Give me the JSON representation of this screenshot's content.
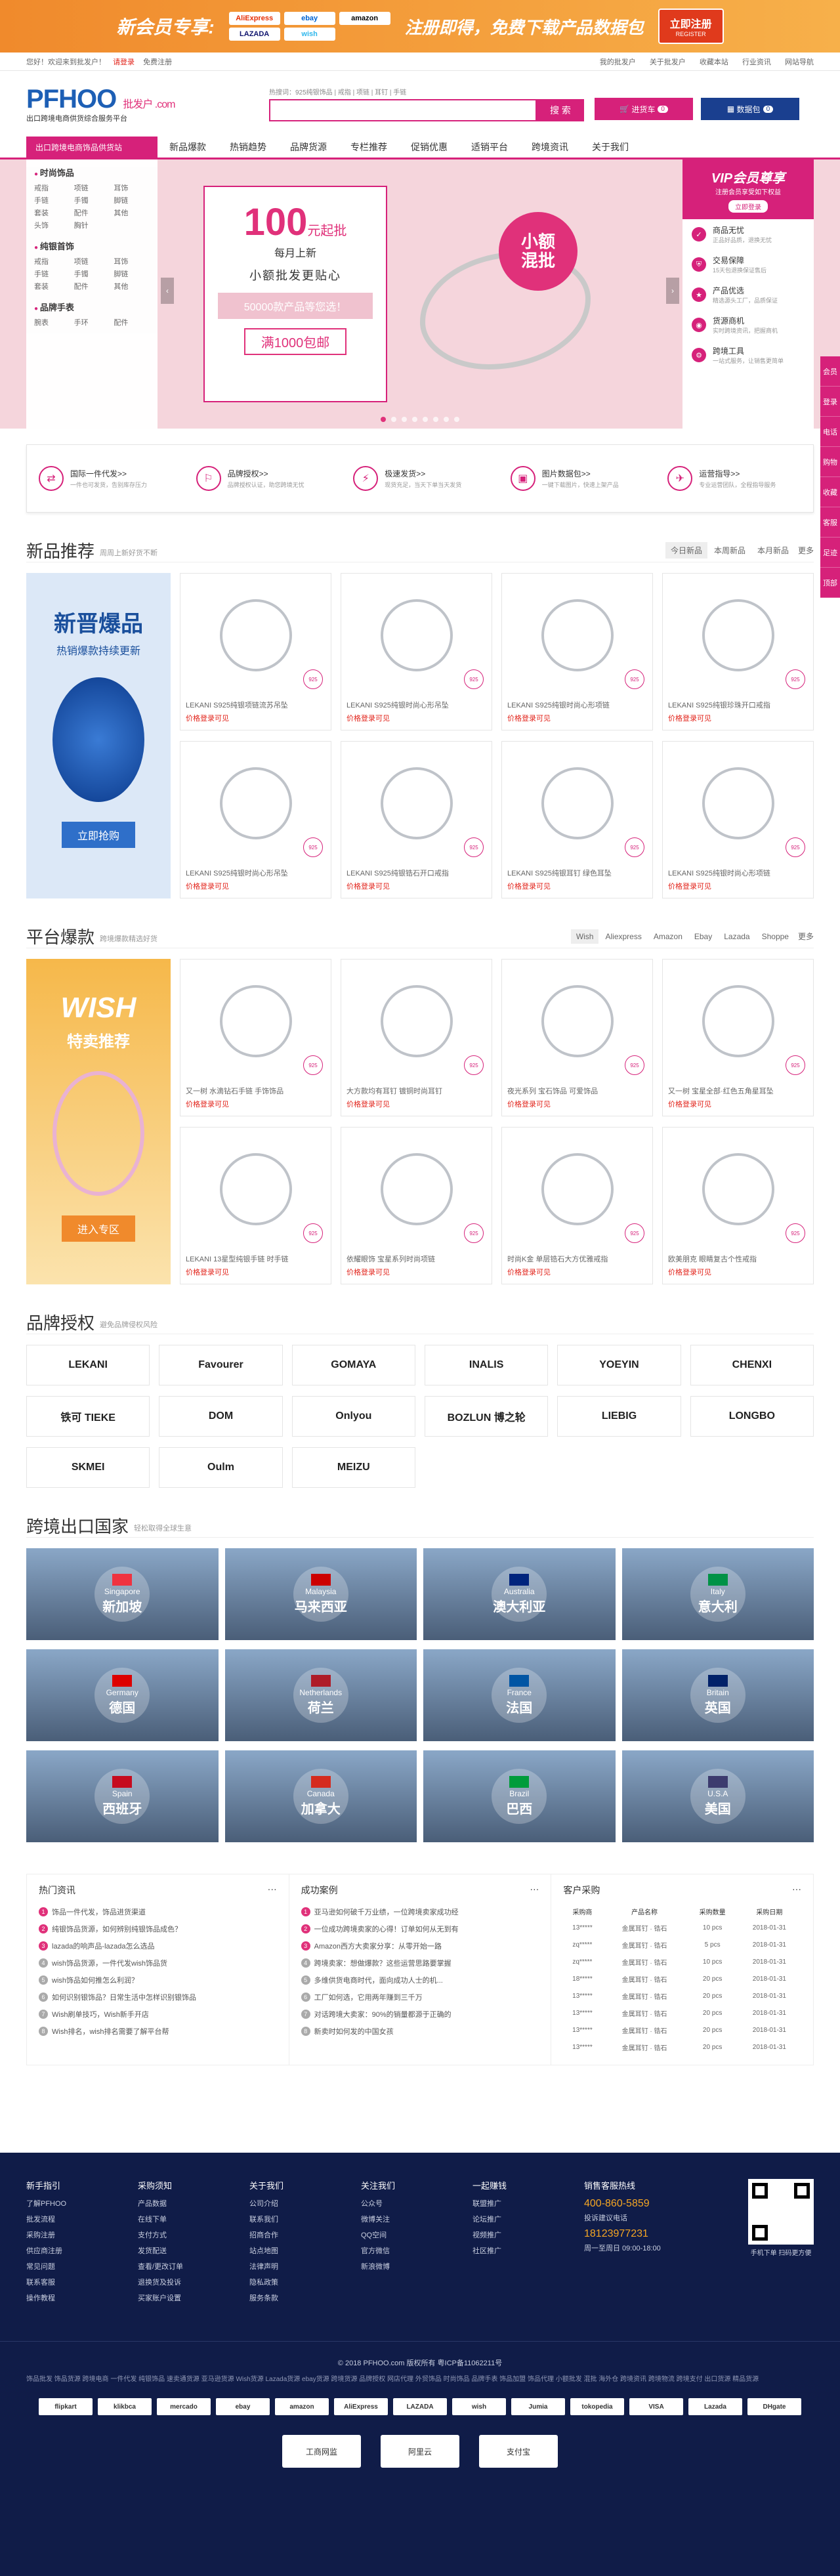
{
  "promo": {
    "title": "新会员专享:",
    "brands": [
      "AliExpress",
      "ebay",
      "amazon",
      "LAZADA",
      "wish"
    ],
    "slogan": "注册即得，免费下载产品数据包",
    "register": "立即注册",
    "register_en": "REGISTER"
  },
  "util": {
    "greeting": "您好！欢迎来到批发户！",
    "login": "请登录",
    "signup": "免费注册",
    "links": [
      "我的批发户",
      "关于批发户",
      "收藏本站",
      "行业资讯",
      "网站导航"
    ]
  },
  "header": {
    "logo": "PFHOO",
    "logo_suffix": "批发户 .com",
    "tagline": "出口跨境电商供货综合服务平台",
    "hot_label": "热搜词：",
    "hot_words": "925纯银饰品 | 戒指 | 项链 | 耳钉 | 手链",
    "search_placeholder": "",
    "search_button": "搜 索",
    "cart_label": "进货车",
    "cart_count": "0",
    "data_label": "数据包",
    "data_count": "0"
  },
  "nav": {
    "category": "出口跨境电商饰品供货站",
    "items": [
      "新品爆款",
      "热销趋势",
      "品牌货源",
      "专栏推荐",
      "促销优惠",
      "适销平台",
      "跨境资讯",
      "关于我们"
    ]
  },
  "catmenu": [
    {
      "title": "时尚饰品",
      "items": [
        "戒指",
        "项链",
        "耳饰",
        "手链",
        "手镯",
        "脚链",
        "套装",
        "配件",
        "其他",
        "头饰",
        "胸针",
        ""
      ]
    },
    {
      "title": "纯银首饰",
      "items": [
        "戒指",
        "项链",
        "耳饰",
        "手链",
        "手镯",
        "脚链",
        "套装",
        "配件",
        "其他"
      ]
    },
    {
      "title": "品牌手表",
      "items": [
        "腕表",
        "手环",
        "配件"
      ]
    }
  ],
  "banner": {
    "price": "100",
    "price_unit": "元起批",
    "per": "每月上新",
    "line2": "小额批发更贴心",
    "line3": "50000款产品等您选！",
    "line4": "满1000包邮",
    "circle": "小额\n混批",
    "dots": 8
  },
  "vip": {
    "title": "VIP会员尊享",
    "sub": "注册会员享受如下权益",
    "btn": "立即登录",
    "items": [
      {
        "title": "商品无忧",
        "desc": "正品好品质，退换无忧"
      },
      {
        "title": "交易保障",
        "desc": "15天包退换保证售后"
      },
      {
        "title": "产品优选",
        "desc": "精选源头工厂，品质保证"
      },
      {
        "title": "货源商机",
        "desc": "实时跨境资讯，把握商机"
      },
      {
        "title": "跨境工具",
        "desc": "一站式服务，让销售更简单"
      }
    ]
  },
  "sidebar": [
    "会员",
    "登录",
    "电话",
    "购物",
    "收藏",
    "客服",
    "足迹",
    "顶部"
  ],
  "services": [
    {
      "title": "国际一件代发>>",
      "desc": "一件也可发货，告别库存压力"
    },
    {
      "title": "品牌授权>>",
      "desc": "品牌授权认证，助您跨境无忧"
    },
    {
      "title": "极速发货>>",
      "desc": "现货充足，当天下单当天发货"
    },
    {
      "title": "图片数据包>>",
      "desc": "一键下载图片，快速上架产品"
    },
    {
      "title": "运营指导>>",
      "desc": "专业运营团队，全程指导服务"
    }
  ],
  "new": {
    "title": "新品推荐",
    "sub": "周周上新好货不断",
    "tabs": [
      "今日新品",
      "本周新品",
      "本月新品"
    ],
    "more": "更多",
    "promo_title": "新晋爆品",
    "promo_sub": "热销爆款持续更新",
    "promo_btn": "立即抢购",
    "products": [
      {
        "name": "LEKANI S925纯银项链流苏吊坠",
        "price": "价格登录可见"
      },
      {
        "name": "LEKANI S925纯银时尚心形吊坠",
        "price": "价格登录可见"
      },
      {
        "name": "LEKANI S925纯银时尚心形项链",
        "price": "价格登录可见"
      },
      {
        "name": "LEKANI S925纯银珍珠开口戒指",
        "price": "价格登录可见"
      },
      {
        "name": "LEKANI S925纯银时尚心形吊坠",
        "price": "价格登录可见"
      },
      {
        "name": "LEKANI S925纯银锆石开口戒指",
        "price": "价格登录可见"
      },
      {
        "name": "LEKANI S925纯银耳钉 绿色耳坠",
        "price": "价格登录可见"
      },
      {
        "name": "LEKANI S925纯银时尚心形项链",
        "price": "价格登录可见"
      }
    ]
  },
  "platform": {
    "title": "平台爆款",
    "sub": "跨境爆款精选好货",
    "tabs": [
      "Wish",
      "Aliexpress",
      "Amazon",
      "Ebay",
      "Lazada",
      "Shoppe"
    ],
    "more": "更多",
    "promo_title": "WISH",
    "promo_sub": "特卖推荐",
    "promo_btn": "进入专区",
    "products": [
      {
        "name": "又一树 水滴钻石手链 手饰饰品",
        "price": "价格登录可见"
      },
      {
        "name": "大方款均有耳钉 镀铜时尚耳钉",
        "price": "价格登录可见"
      },
      {
        "name": "夜光系列 宝石饰品 可爱饰品",
        "price": "价格登录可见"
      },
      {
        "name": "又一树 宝星全部·红色五角星耳坠",
        "price": "价格登录可见"
      },
      {
        "name": "LEKANI 13星型纯银手链 时手链",
        "price": "价格登录可见"
      },
      {
        "name": "依耀眼饰 宝星系列时尚项链",
        "price": "价格登录可见"
      },
      {
        "name": "时尚K金 单层锆石大方优雅戒指",
        "price": "价格登录可见"
      },
      {
        "name": "欧美朋克 眼睛复古个性戒指",
        "price": "价格登录可见"
      }
    ]
  },
  "brands": {
    "title": "品牌授权",
    "sub": "避免品牌侵权风险",
    "items": [
      "LEKANI",
      "Favourer",
      "GOMAYA",
      "INALIS",
      "YOEYIN",
      "CHENXI",
      "铁可 TIEKE",
      "DOM",
      "Onlyou",
      "BOZLUN 博之轮",
      "LIEBIG",
      "LONGBO",
      "SKMEI",
      "Oulm",
      "MEIZU"
    ]
  },
  "countries": {
    "title": "跨境出口国家",
    "sub": "轻松取得全球生意",
    "items": [
      {
        "en": "Singapore",
        "zh": "新加坡",
        "flag": "#ef3340"
      },
      {
        "en": "Malaysia",
        "zh": "马来西亚",
        "flag": "#cc0001"
      },
      {
        "en": "Australia",
        "zh": "澳大利亚",
        "flag": "#00247d"
      },
      {
        "en": "Italy",
        "zh": "意大利",
        "flag": "#009246"
      },
      {
        "en": "Germany",
        "zh": "德国",
        "flag": "#dd0000"
      },
      {
        "en": "Netherlands",
        "zh": "荷兰",
        "flag": "#ae1c28"
      },
      {
        "en": "France",
        "zh": "法国",
        "flag": "#0055a4"
      },
      {
        "en": "Britain",
        "zh": "英国",
        "flag": "#012169"
      },
      {
        "en": "Spain",
        "zh": "西班牙",
        "flag": "#c60b1e"
      },
      {
        "en": "Canada",
        "zh": "加拿大",
        "flag": "#d52b1e"
      },
      {
        "en": "Brazil",
        "zh": "巴西",
        "flag": "#009c3b"
      },
      {
        "en": "U.S.A",
        "zh": "美国",
        "flag": "#3c3b6e"
      }
    ]
  },
  "news": {
    "hot_title": "热门资讯",
    "hot": [
      "饰品一件代发，饰品进货渠道",
      "纯银饰品货源，如何辨别纯银饰品成色？",
      "lazada的响声品-lazada怎么选品",
      "wish饰品货源，一件代发wish饰品货",
      "wish饰品如何推怎么利润？",
      "如何识别银饰品？日常生活中怎样识别银饰品",
      "Wish刷单技巧，Wish新手开店",
      "Wish排名，wish排名需要了解平台帮"
    ],
    "case_title": "成功案例",
    "cases": [
      "亚马逊如何破千万业绩，一位跨境卖家成功经",
      "一位成功跨境卖家的心得！订单如何从无到有",
      "Amazon西方大卖家分享：从零开始一路",
      "跨境卖家：想做爆款？这些运营思路要掌握",
      "多维供货电商时代，面向成功人士的机...",
      "工厂如何选，它用两年赚到三千万",
      "对话跨境大卖家：90%的销量都源于正确的",
      "新卖时如何发的中国女孩"
    ],
    "buy_title": "客户采购",
    "buy_headers": [
      "采购商",
      "产品名称",
      "采购数量",
      "采购日期"
    ],
    "buy_rows": [
      [
        "13*****",
        "金属耳钉 · 锆石",
        "10 pcs",
        "2018-01-31"
      ],
      [
        "zq*****",
        "金属耳钉 · 锆石",
        "5 pcs",
        "2018-01-31"
      ],
      [
        "zq*****",
        "金属耳钉 · 锆石",
        "10 pcs",
        "2018-01-31"
      ],
      [
        "18*****",
        "金属耳钉 · 锆石",
        "20 pcs",
        "2018-01-31"
      ],
      [
        "13*****",
        "金属耳钉 · 锆石",
        "20 pcs",
        "2018-01-31"
      ],
      [
        "13*****",
        "金属耳钉 · 锆石",
        "20 pcs",
        "2018-01-31"
      ],
      [
        "13*****",
        "金属耳钉 · 锆石",
        "20 pcs",
        "2018-01-31"
      ],
      [
        "13*****",
        "金属耳钉 · 锆石",
        "20 pcs",
        "2018-01-31"
      ]
    ]
  },
  "footer": {
    "cols": [
      {
        "title": "新手指引",
        "items": [
          "了解PFHOO",
          "批发流程",
          "采购注册",
          "供应商注册",
          "常见问题",
          "联系客服",
          "操作教程"
        ]
      },
      {
        "title": "采购须知",
        "items": [
          "产品数据",
          "在线下单",
          "支付方式",
          "发货配送",
          "查看/更改订单",
          "退换货及投诉",
          "买家账户设置"
        ]
      },
      {
        "title": "关于我们",
        "items": [
          "公司介绍",
          "联系我们",
          "招商合作",
          "站点地图",
          "法律声明",
          "隐私政策",
          "服务条款"
        ]
      },
      {
        "title": "关注我们",
        "items": [
          "公众号",
          "微博关注",
          "QQ空间",
          "官方微信",
          "新浪微博"
        ]
      },
      {
        "title": "一起赚钱",
        "items": [
          "联盟推广",
          "论坛推广",
          "视频推广",
          "社区推广"
        ]
      }
    ],
    "contact_title": "销售客服热线",
    "tel1": "400-860-5859",
    "contact_mid": "投诉建议电话",
    "tel2": "18123977231",
    "hours": "周一至周日 09:00-18:00",
    "qr_label": "手机下单 扫码更方便",
    "copyright": "© 2018 PFHOO.com 版权所有  粤ICP备11062211号",
    "links": "饰品批发  饰品货源  跨境电商  一件代发  纯银饰品  速卖通货源  亚马逊货源  Wish货源  Lazada货源  ebay货源  跨境货源  品牌授权  网店代理  外贸饰品  时尚饰品  品牌手表  饰品加盟  饰品代理  小额批发  混批  海外仓  跨境资讯  跨境物流  跨境支付  出口货源  精品货源",
    "pays": [
      "flipkart",
      "klikbca",
      "mercado",
      "ebay",
      "amazon",
      "AliExpress",
      "LAZADA",
      "wish",
      "Jumia",
      "tokopedia",
      "VISA",
      "Lazada",
      "DHgate"
    ],
    "certs": [
      "工商网监",
      "阿里云",
      "支付宝"
    ]
  }
}
